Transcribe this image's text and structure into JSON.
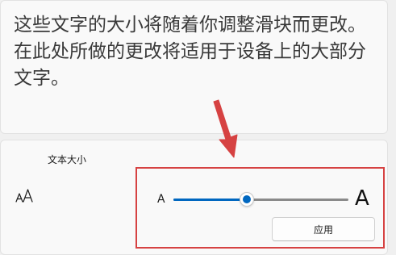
{
  "preview": {
    "text": "这些文字的大小将随着你调整滑块而更改。在此处所做的更改将适用于设备上的大部分文字。"
  },
  "text_size": {
    "title": "文本大小",
    "small_label": "A",
    "large_label": "A",
    "slider_value": 0.42,
    "apply_label": "应用",
    "icon": "text-size-icon"
  },
  "colors": {
    "accent": "#0067c0",
    "annotation": "#d64242"
  }
}
